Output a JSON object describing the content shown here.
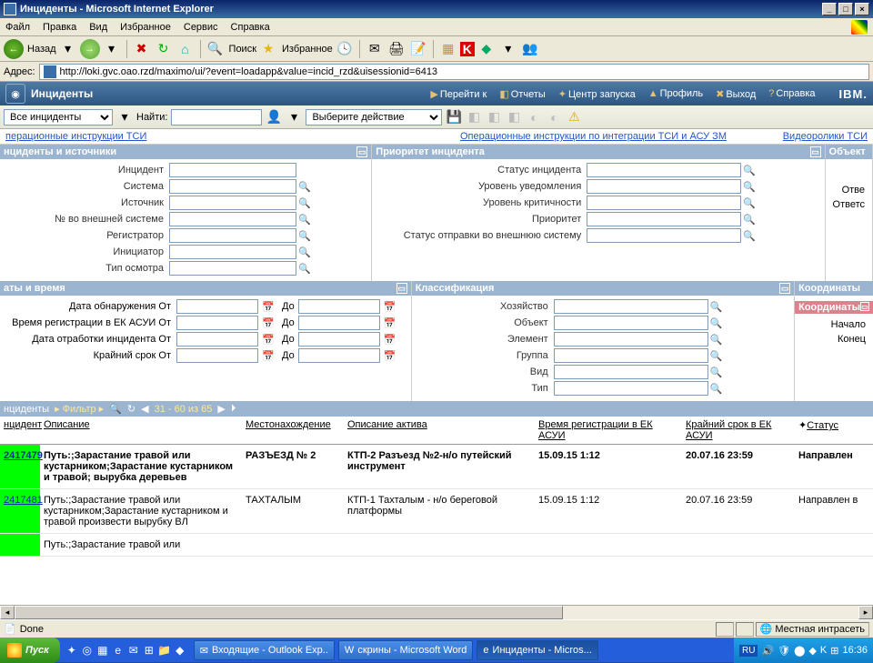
{
  "window": {
    "title": "Инциденты - Microsoft Internet Explorer"
  },
  "ie_menu": [
    "Файл",
    "Правка",
    "Вид",
    "Избранное",
    "Сервис",
    "Справка"
  ],
  "ie_toolbar": {
    "back": "Назад",
    "search": "Поиск",
    "favorites": "Избранное"
  },
  "address": {
    "label": "Адрес:",
    "url": "http://loki.gvc.oao.rzd/maximo/ui/?event=loadapp&value=incid_rzd&uisessionid=6413"
  },
  "maximo": {
    "title": "Инциденты",
    "goto": "Перейти к",
    "reports": "Отчеты",
    "start": "Центр запуска",
    "profile": "Профиль",
    "signout": "Выход",
    "help": "Справка",
    "ibm": "IBM."
  },
  "filterbar": {
    "view": "Все инциденты",
    "find_label": "Найти:",
    "action_label": "Выберите действие"
  },
  "linksrow": {
    "left": "перационные инструкции ТСИ",
    "center": "Операционные инструкции по интеграции ТСИ и АСУ ЗМ",
    "right": "Видеоролики ТСИ"
  },
  "section1": {
    "title": "нциденты и источники",
    "fields": [
      "Инцидент",
      "Система",
      "Источник",
      "№ во внешней системе",
      "Регистратор",
      "Инициатор",
      "Тип осмотра"
    ]
  },
  "section2": {
    "title": "Приоритет инцидента",
    "fields": [
      "Статус инцидента",
      "Уровень уведомления",
      "Уровень критичности",
      "Приоритет",
      "Статус отправки во внешнюю систему"
    ]
  },
  "section3": {
    "title": "Объект",
    "fields": [
      "Отве",
      "Ответс"
    ]
  },
  "section4": {
    "title": "аты и время",
    "rows": [
      {
        "label": "Дата обнаружения От",
        "to": "До"
      },
      {
        "label": "Время регистрации в ЕК АСУИ От",
        "to": "До"
      },
      {
        "label": "Дата отработки инцидента От",
        "to": "До"
      },
      {
        "label": "Крайний срок От",
        "to": "До"
      }
    ]
  },
  "section5": {
    "title": "Классификация",
    "fields": [
      "Хозяйство",
      "Объект",
      "Элемент",
      "Группа",
      "Вид",
      "Тип"
    ]
  },
  "section6": {
    "title": "Координаты",
    "subtitle": "Координаты",
    "fields": [
      "Начало",
      "Конец"
    ]
  },
  "results": {
    "title": "нциденты",
    "filter": "Фильтр",
    "pager": "31 - 60 из 65",
    "columns": [
      "нцидент",
      "Описание",
      "Местонахождение",
      "Описание актива",
      "Время регистрации в ЕК АСУИ",
      "Крайний срок в ЕК АСУИ",
      "Статус"
    ],
    "rows": [
      {
        "id": "2417479",
        "desc": "Путь:;Зарастание травой или кустарником;Зарастание кустарником и травой; вырубка деревьев",
        "loc": "РАЗЪЕЗД № 2",
        "asset": "КТП-2 Разъезд №2-н/о путейский инструмент",
        "reg": "15.09.15 1:12",
        "deadline": "20.07.16 23:59",
        "status": "Направлен",
        "bold": true
      },
      {
        "id": "2417481",
        "desc": "Путь:;Зарастание травой или кустарником;Зарастание кустарником и травой произвести вырубку ВЛ",
        "loc": "ТАХТАЛЫМ",
        "asset": "КТП-1 Тахталым - н/о береговой платформы",
        "reg": "15.09.15 1:12",
        "deadline": "20.07.16 23:59",
        "status": "Направлен в",
        "bold": false
      },
      {
        "id": "",
        "desc": "Путь:;Зарастание травой или",
        "loc": "",
        "asset": "",
        "reg": "",
        "deadline": "",
        "status": "",
        "bold": false
      }
    ]
  },
  "ie_status": {
    "done": "Done",
    "intranet": "Местная интрасеть"
  },
  "taskbar": {
    "start": "Пуск",
    "tasks": [
      {
        "label": "Входящие - Outlook Exp..",
        "icon": "✉"
      },
      {
        "label": "скрины - Microsoft Word",
        "icon": "W"
      },
      {
        "label": "Инциденты - Micros...",
        "icon": "e",
        "active": true
      }
    ],
    "lang": "RU",
    "clock": "16:36"
  }
}
